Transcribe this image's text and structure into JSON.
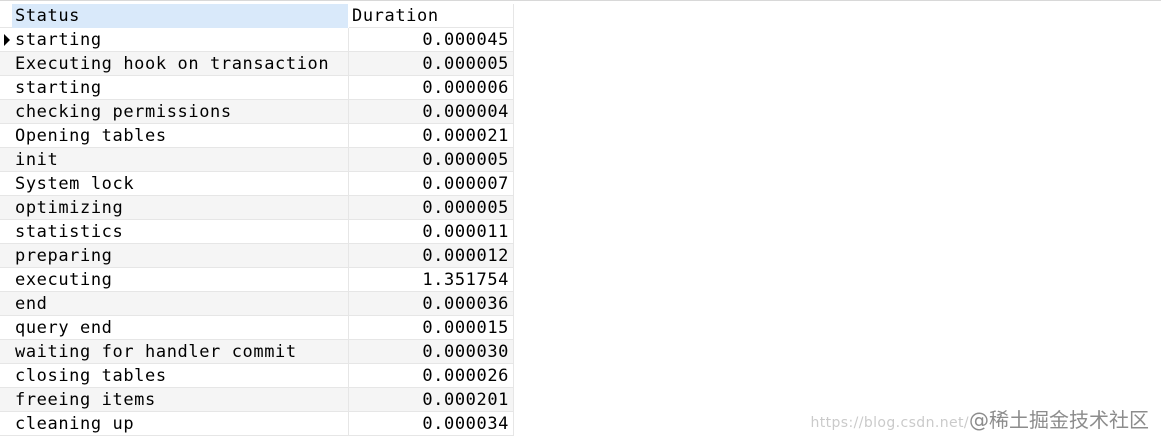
{
  "grid": {
    "columns": {
      "status": "Status",
      "duration": "Duration"
    },
    "current_row": 0,
    "rows": [
      {
        "status": "starting",
        "duration": "0.000045"
      },
      {
        "status": "Executing hook on transaction",
        "duration": "0.000005"
      },
      {
        "status": "starting",
        "duration": "0.000006"
      },
      {
        "status": "checking permissions",
        "duration": "0.000004"
      },
      {
        "status": "Opening tables",
        "duration": "0.000021"
      },
      {
        "status": "init",
        "duration": "0.000005"
      },
      {
        "status": "System lock",
        "duration": "0.000007"
      },
      {
        "status": "optimizing",
        "duration": "0.000005"
      },
      {
        "status": "statistics",
        "duration": "0.000011"
      },
      {
        "status": "preparing",
        "duration": "0.000012"
      },
      {
        "status": "executing",
        "duration": "1.351754"
      },
      {
        "status": "end",
        "duration": "0.000036"
      },
      {
        "status": "query end",
        "duration": "0.000015"
      },
      {
        "status": "waiting for handler commit",
        "duration": "0.000030"
      },
      {
        "status": "closing tables",
        "duration": "0.000026"
      },
      {
        "status": "freeing items",
        "duration": "0.000201"
      },
      {
        "status": "cleaning up",
        "duration": "0.000034"
      }
    ]
  },
  "watermark": {
    "site": "https://blog.csdn.net/",
    "brand": "@稀土掘金技术社区"
  },
  "colors": {
    "header_status_bg": "#d9e9fa",
    "zebra_bg": "#f5f5f5",
    "gridline": "#e6e6e6"
  }
}
